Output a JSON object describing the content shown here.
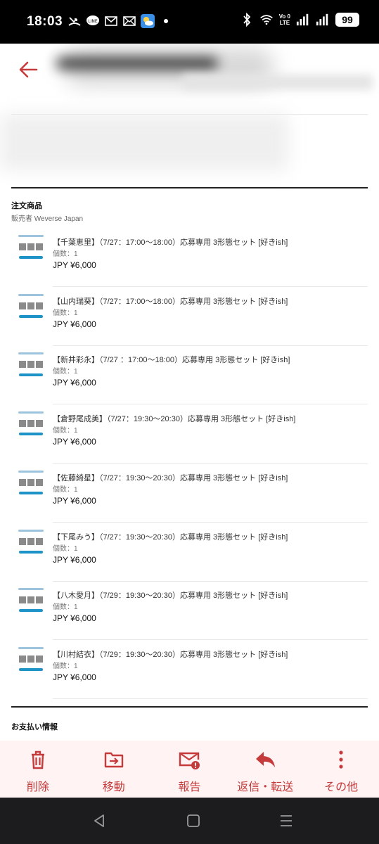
{
  "status": {
    "time": "18:03",
    "battery": "99",
    "network": "LTE"
  },
  "order": {
    "section_title": "注文商品",
    "seller_label": "販売者",
    "seller_name": "Weverse Japan",
    "items": [
      {
        "name": "【千葉恵里】（7/27：17:00～18:00）応募専用 3形態セット [好きish]",
        "qty": "個数：1",
        "price": "JPY ¥6,000"
      },
      {
        "name": "【山内瑞葵】（7/27：17:00～18:00）応募専用 3形態セット [好きish]",
        "qty": "個数：1",
        "price": "JPY ¥6,000"
      },
      {
        "name": "【新井彩永】（7/27 ：17:00～18:00）応募専用 3形態セット [好きish]",
        "qty": "個数：1",
        "price": "JPY ¥6,000"
      },
      {
        "name": "【倉野尾成美】（7/27：19:30～20:30）応募専用 3形態セット [好きish]",
        "qty": "個数：1",
        "price": "JPY ¥6,000"
      },
      {
        "name": "【佐藤綺星】（7/27：19:30～20:30）応募専用 3形態セット [好きish]",
        "qty": "個数：1",
        "price": "JPY ¥6,000"
      },
      {
        "name": "【下尾みう】（7/27：19:30～20:30）応募専用 3形態セット [好きish]",
        "qty": "個数：1",
        "price": "JPY ¥6,000"
      },
      {
        "name": "【八木愛月】（7/29：19:30～20:30）応募専用 3形態セット [好きish]",
        "qty": "個数：1",
        "price": "JPY ¥6,000"
      },
      {
        "name": "【川村結衣】（7/29：19:30～20:30）応募専用 3形態セット [好きish]",
        "qty": "個数：1",
        "price": "JPY ¥6,000"
      }
    ]
  },
  "payment": {
    "section_title": "お支払い情報"
  },
  "toolbar": {
    "delete_label": "削除",
    "move_label": "移動",
    "report_label": "報告",
    "reply_forward_label": "返信・転送",
    "more_label": "その他"
  },
  "colors": {
    "accent": "#c53a3a",
    "toolbar_bg": "#fff3f3",
    "thumb_blue": "#1e93c7"
  },
  "icons": {
    "back": "arrow-left-icon",
    "delete": "trash-icon",
    "move": "folder-move-icon",
    "report": "mail-alert-icon",
    "reply": "reply-icon",
    "more": "dots-vertical-icon"
  }
}
